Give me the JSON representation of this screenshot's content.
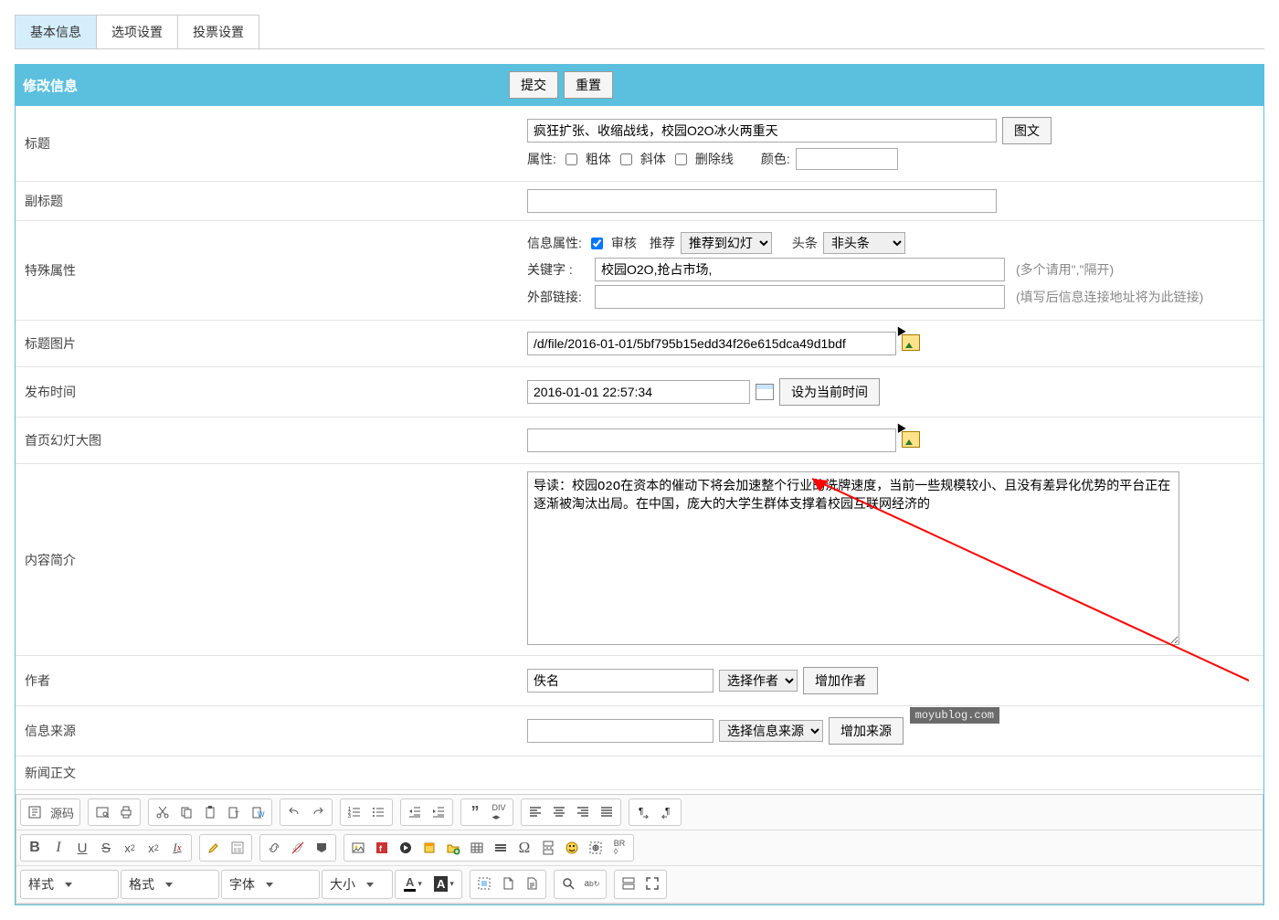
{
  "tabs": {
    "basic": "基本信息",
    "options": "选项设置",
    "vote": "投票设置"
  },
  "panel": {
    "title": "修改信息",
    "submit": "提交",
    "reset": "重置"
  },
  "form": {
    "title_label": "标题",
    "title_value": "疯狂扩张、收缩战线，校园O2O冰火两重天",
    "title_btn": "图文",
    "attr_label": "属性:",
    "bold": "粗体",
    "italic": "斜体",
    "strike": "删除线",
    "color_label": "颜色:",
    "subtitle_label": "副标题",
    "special_label": "特殊属性",
    "info_attr_label": "信息属性:",
    "audit": "审核",
    "recommend": "推荐",
    "recommend_select": "推荐到幻灯",
    "headline_label": "头条",
    "headline_select": "非头条",
    "keyword_label": "关键字   :",
    "keyword_value": "校园O2O,抢占市场,",
    "keyword_hint": "(多个请用\",\"隔开)",
    "extlink_label": "外部链接:",
    "extlink_hint": "(填写后信息连接地址将为此链接)",
    "titlepic_label": "标题图片",
    "titlepic_value": "/d/file/2016-01-01/5bf795b15edd34f26e615dca49d1bdf",
    "pubtime_label": "发布时间",
    "pubtime_value": "2016-01-01 22:57:34",
    "pubtime_btn": "设为当前时间",
    "slide_label": "首页幻灯大图",
    "intro_label": "内容简介",
    "intro_value": "导读：校园O2O在资本的催动下将会加速整个行业的洗牌速度，当前一些规模较小、且没有差异化优势的平台正在逐渐被淘汰出局。在中国，庞大的大学生群体支撑着校园互联网经济的",
    "author_label": "作者",
    "author_value": "佚名",
    "author_select": "选择作者",
    "author_add": "增加作者",
    "source_label": "信息来源",
    "source_select": "选择信息来源",
    "source_add": "增加来源",
    "newsbody_label": "新闻正文"
  },
  "editor": {
    "source": "源码",
    "combo_style": "样式",
    "combo_format": "格式",
    "combo_font": "字体",
    "combo_size": "大小"
  },
  "watermark": "moyublog.com"
}
